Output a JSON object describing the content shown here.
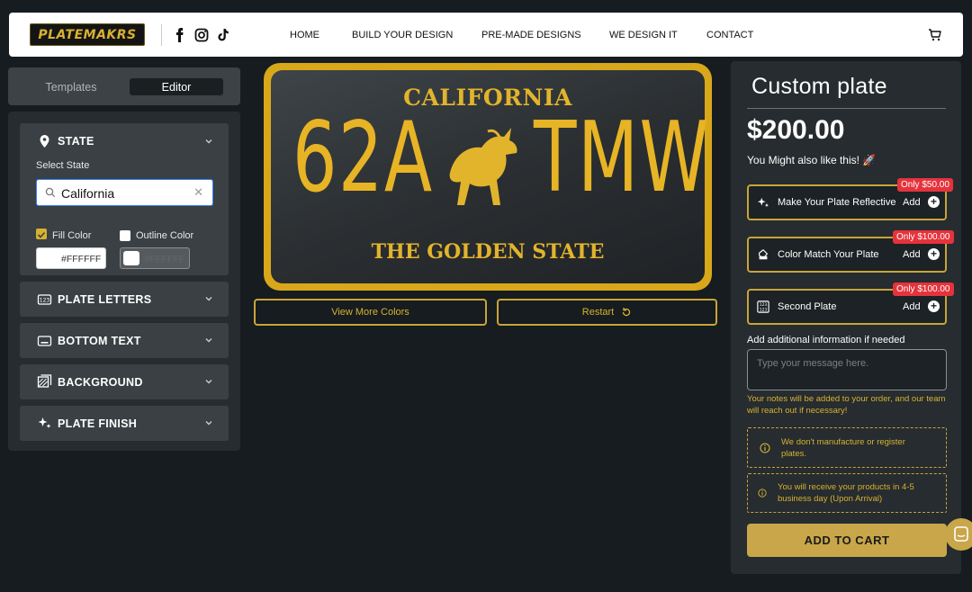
{
  "header": {
    "logo": "PLATEMAKRS",
    "nav": [
      "HOME",
      "BUILD YOUR DESIGN",
      "PRE-MADE DESIGNS",
      "WE DESIGN IT",
      "CONTACT"
    ]
  },
  "editor": {
    "tabs": [
      "Templates",
      "Editor"
    ],
    "active_tab": "Editor",
    "sections": [
      "STATE",
      "PLATE LETTERS",
      "BOTTOM TEXT",
      "BACKGROUND",
      "PLATE FINISH"
    ],
    "state": {
      "select_label": "Select State",
      "value": "California",
      "fill_label": "Fill Color",
      "fill_checked": true,
      "fill_hex": "#FFFFFF",
      "outline_label": "Outline Color",
      "outline_checked": false,
      "outline_hex": "#FFFFFF"
    }
  },
  "plate": {
    "state": "CALIFORNIA",
    "left": "62A",
    "right": "TMW",
    "bottom": "THE GOLDEN STATE",
    "colors": {
      "frame": "#d9a71a",
      "text": "#e7b425",
      "background": "#2b2f32"
    }
  },
  "controls": {
    "view_colors": "View More Colors",
    "restart": "Restart"
  },
  "product": {
    "title": "Custom plate",
    "price": "$200.00",
    "upsell_title": "You Might also like this! 🚀",
    "upsells": [
      {
        "label": "Make Your Plate Reflective",
        "add": "Add",
        "badge": "Only $50.00",
        "icon": "sparkle-icon"
      },
      {
        "label": "Color Match Your Plate",
        "add": "Add",
        "badge": "Only $100.00",
        "icon": "paint-bucket-icon"
      },
      {
        "label": "Second Plate",
        "add": "Add",
        "badge": "Only $100.00",
        "icon": "plate-icon"
      }
    ],
    "additional_label": "Add additional information if needed",
    "message_placeholder": "Type your message here.",
    "note": "Your notes will be added to your order, and our team will reach out if necessary!",
    "info": [
      "We don't manufacture or register plates.",
      "You will receive your products in 4-5 business day (Upon Arrival)"
    ],
    "add_to_cart": "ADD TO CART"
  },
  "theme": {
    "accent": "#c9a43a",
    "panel": "#262c2f",
    "background": "#161c1f",
    "badge": "#e5333c"
  }
}
